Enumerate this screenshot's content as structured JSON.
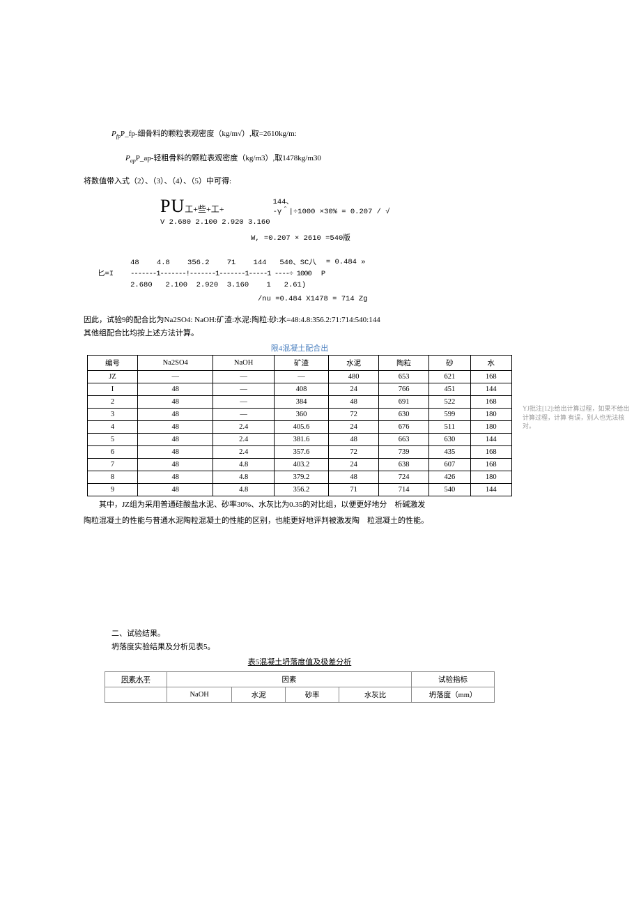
{
  "def_fine": "P_fp-细骨料的颗粒表观密度（kg/m√）,取=2610kg/m:",
  "def_coarse": "P_ap-轻粗骨料的颗粒表观密度（kg/m3）,取1478kg/m30",
  "bring_in": "将数值带入式（2）、（3）、（4）、（5）中可得:",
  "pu_line": "PU",
  "pu_suffix": "工+些+工+",
  "pu_right1": "144、",
  "pu_right2": "-γ＾|÷1000 ×30% = 0.207 / √",
  "v_line": "V 2.680 2.100 2.920 3.160",
  "w_line": "W, =0.207 × 2610 =540版",
  "hi_label": "匕=I",
  "hi_top": "48    4.8    356.2    71    144   540、SC八",
  "hi_eq": "= 0.484 »",
  "hi_dash": "-------1-------!-------1-------1-----1 ----÷ 1000",
  "hi_p": "P",
  "hi_bot": "2.680   2.100  2.920  3.160    1   2.61)",
  "nu_line": "/nu =0.484 X1478 = 714 Zg",
  "therefore": "因此，试验9的配合比为Na2SO4: NaOH:矿渣:水泥:陶粒:砂:水=48:4.8:356.2:71:714:540:144",
  "other": "其他组配合比均按上述方法计算。",
  "t4_caption": "限4混凝土配合出",
  "t4_headers": [
    "编号",
    "Na2SO4",
    "NaOH",
    "矿渣",
    "水泥",
    "陶粒",
    "砂",
    "水"
  ],
  "t4_rows": [
    [
      "JZ",
      "—",
      "—",
      "—",
      "480",
      "653",
      "621",
      "168"
    ],
    [
      "I",
      "48",
      "—",
      "408",
      "24",
      "766",
      "451",
      "144"
    ],
    [
      "2",
      "48",
      "—",
      "384",
      "48",
      "691",
      "522",
      "168"
    ],
    [
      "3",
      "48",
      "—",
      "360",
      "72",
      "630",
      "599",
      "180"
    ],
    [
      "4",
      "48",
      "2.4",
      "405.6",
      "24",
      "676",
      "511",
      "180"
    ],
    [
      "5",
      "48",
      "2.4",
      "381.6",
      "48",
      "663",
      "630",
      "144"
    ],
    [
      "6",
      "48",
      "2.4",
      "357.6",
      "72",
      "739",
      "435",
      "168"
    ],
    [
      "7",
      "48",
      "4.8",
      "403.2",
      "24",
      "638",
      "607",
      "168"
    ],
    [
      "8",
      "48",
      "4.8",
      "379.2",
      "48",
      "724",
      "426",
      "180"
    ],
    [
      "9",
      "48",
      "4.8",
      "356.2",
      "71",
      "714",
      "540",
      "144"
    ]
  ],
  "t4_note1": "其中，JZ组为采用普通硅酸盐水泥、砂率30%、水灰比为0.35的对比组，以便更好地分　析碱激发",
  "t4_note2": "陶粒混凝土的性能与普通水泥陶粒混凝土的性能的区别，也能更好地评判被激发陶　粒混凝土的性能。",
  "sec2_title": "二、试验结果。",
  "sec2_line": "坍落度实验结果及分析见表5。",
  "t5_caption": "表5混凝土坍落度值及极差分析",
  "t5_h1_left": "因素水平",
  "t5_h1_mid": "因素",
  "t5_h1_right": "试验指标",
  "t5_h2": [
    "",
    "NaOH",
    "水泥",
    "砂率",
    "水灰比",
    "坍落度（mm）"
  ],
  "comment_label": "YJ批注[12]:",
  "comment_text": "给出计算过程，如果不给出计算过程，计算 有误，别人也无法核对。"
}
